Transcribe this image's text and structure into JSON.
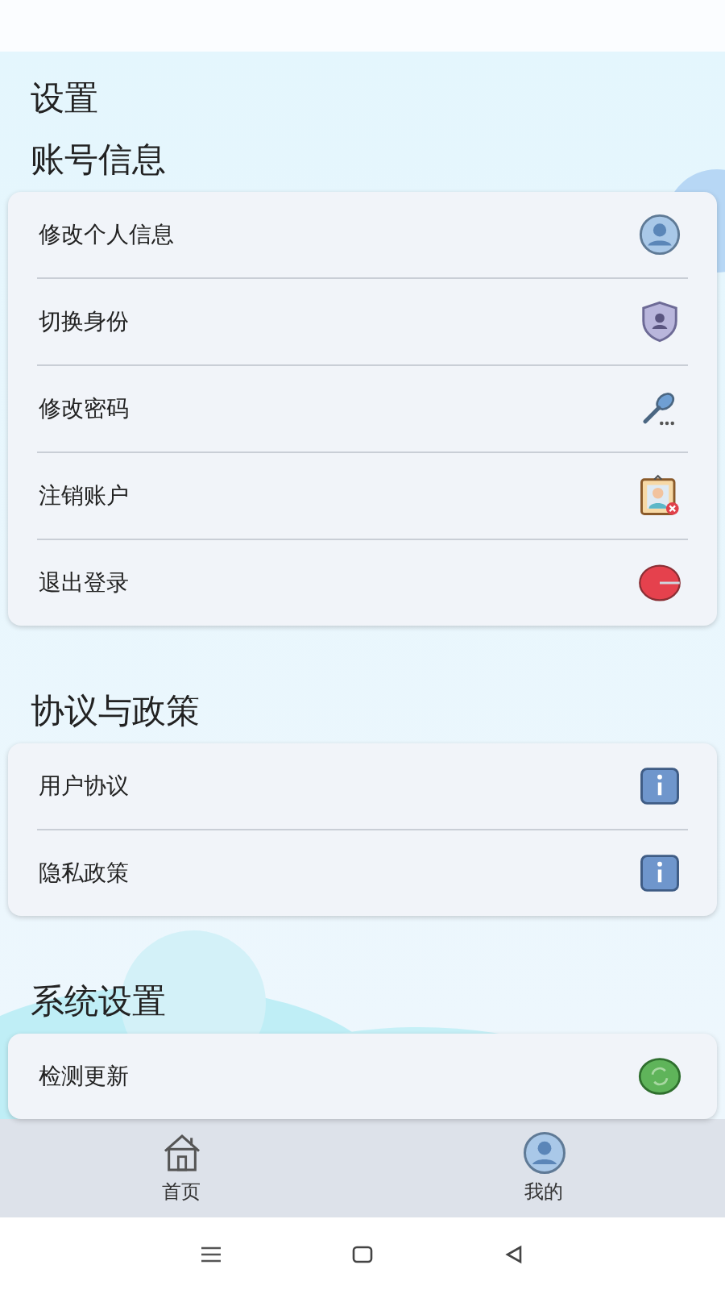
{
  "page_title": "设置",
  "sections": [
    {
      "title": "账号信息",
      "items": [
        {
          "label": "修改个人信息"
        },
        {
          "label": "切换身份"
        },
        {
          "label": "修改密码"
        },
        {
          "label": "注销账户"
        },
        {
          "label": "退出登录"
        }
      ]
    },
    {
      "title": "协议与政策",
      "items": [
        {
          "label": "用户协议"
        },
        {
          "label": "隐私政策"
        }
      ]
    },
    {
      "title": "系统设置",
      "items": [
        {
          "label": "检测更新"
        }
      ]
    }
  ],
  "tabs": [
    {
      "label": "首页"
    },
    {
      "label": "我的"
    }
  ]
}
